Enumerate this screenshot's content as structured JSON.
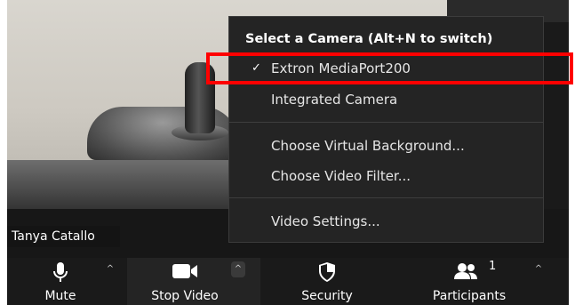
{
  "participant": {
    "name": "Tanya Catallo"
  },
  "camera_menu": {
    "header": "Select a Camera (Alt+N to switch)",
    "items": [
      {
        "label": "Extron MediaPort200",
        "selected": true
      },
      {
        "label": "Integrated Camera",
        "selected": false
      },
      {
        "label": "Choose Virtual Background...",
        "selected": false
      },
      {
        "label": "Choose Video Filter...",
        "selected": false
      },
      {
        "label": "Video Settings...",
        "selected": false
      }
    ],
    "check_glyph": "✓"
  },
  "toolbar": {
    "mute_label": "Mute",
    "stop_video_label": "Stop Video",
    "security_label": "Security",
    "participants_label": "Participants",
    "participants_count": "1",
    "caret_glyph": "^"
  },
  "colors": {
    "highlight": "#ff0000",
    "menu_bg": "#242424",
    "toolbar_bg": "#1a1a1a"
  },
  "icons": [
    "microphone-icon",
    "video-camera-icon",
    "shield-icon",
    "participants-icon",
    "caret-up-icon",
    "checkmark-icon"
  ]
}
